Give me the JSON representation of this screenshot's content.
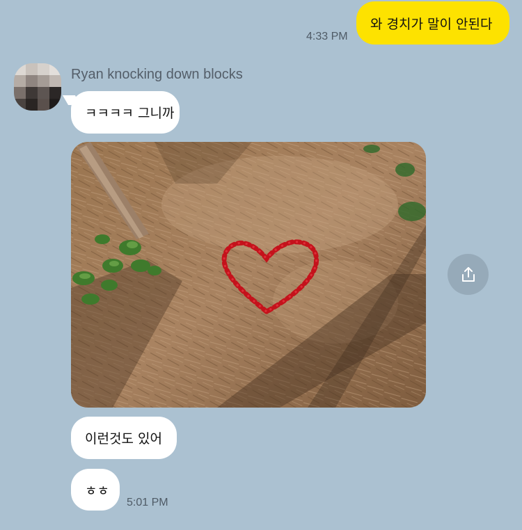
{
  "messages": {
    "outgoing_1": {
      "text": "와 경치가 말이 안된다",
      "time": "4:33 PM"
    },
    "sender_name": "Ryan knocking down blocks",
    "incoming_1": {
      "text": "ㅋㅋㅋㅋ 그니까"
    },
    "incoming_3": {
      "text": "이런것도 있어"
    },
    "incoming_4": {
      "text": "ㅎㅎ",
      "time": "5:01 PM"
    }
  },
  "colors": {
    "background": "#abc1d1",
    "my_bubble": "#fde200",
    "their_bubble": "#ffffff"
  },
  "icons": {
    "share": "share-icon"
  }
}
